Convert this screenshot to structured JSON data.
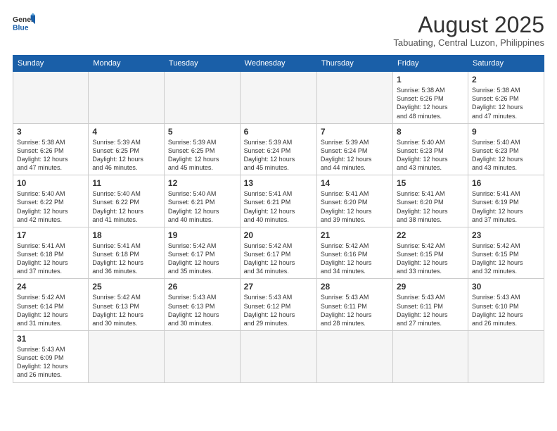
{
  "header": {
    "logo_general": "General",
    "logo_blue": "Blue",
    "month_year": "August 2025",
    "location": "Tabuating, Central Luzon, Philippines"
  },
  "weekdays": [
    "Sunday",
    "Monday",
    "Tuesday",
    "Wednesday",
    "Thursday",
    "Friday",
    "Saturday"
  ],
  "weeks": [
    [
      {
        "day": "",
        "info": ""
      },
      {
        "day": "",
        "info": ""
      },
      {
        "day": "",
        "info": ""
      },
      {
        "day": "",
        "info": ""
      },
      {
        "day": "",
        "info": ""
      },
      {
        "day": "1",
        "info": "Sunrise: 5:38 AM\nSunset: 6:26 PM\nDaylight: 12 hours\nand 48 minutes."
      },
      {
        "day": "2",
        "info": "Sunrise: 5:38 AM\nSunset: 6:26 PM\nDaylight: 12 hours\nand 47 minutes."
      }
    ],
    [
      {
        "day": "3",
        "info": "Sunrise: 5:38 AM\nSunset: 6:26 PM\nDaylight: 12 hours\nand 47 minutes."
      },
      {
        "day": "4",
        "info": "Sunrise: 5:39 AM\nSunset: 6:25 PM\nDaylight: 12 hours\nand 46 minutes."
      },
      {
        "day": "5",
        "info": "Sunrise: 5:39 AM\nSunset: 6:25 PM\nDaylight: 12 hours\nand 45 minutes."
      },
      {
        "day": "6",
        "info": "Sunrise: 5:39 AM\nSunset: 6:24 PM\nDaylight: 12 hours\nand 45 minutes."
      },
      {
        "day": "7",
        "info": "Sunrise: 5:39 AM\nSunset: 6:24 PM\nDaylight: 12 hours\nand 44 minutes."
      },
      {
        "day": "8",
        "info": "Sunrise: 5:40 AM\nSunset: 6:23 PM\nDaylight: 12 hours\nand 43 minutes."
      },
      {
        "day": "9",
        "info": "Sunrise: 5:40 AM\nSunset: 6:23 PM\nDaylight: 12 hours\nand 43 minutes."
      }
    ],
    [
      {
        "day": "10",
        "info": "Sunrise: 5:40 AM\nSunset: 6:22 PM\nDaylight: 12 hours\nand 42 minutes."
      },
      {
        "day": "11",
        "info": "Sunrise: 5:40 AM\nSunset: 6:22 PM\nDaylight: 12 hours\nand 41 minutes."
      },
      {
        "day": "12",
        "info": "Sunrise: 5:40 AM\nSunset: 6:21 PM\nDaylight: 12 hours\nand 40 minutes."
      },
      {
        "day": "13",
        "info": "Sunrise: 5:41 AM\nSunset: 6:21 PM\nDaylight: 12 hours\nand 40 minutes."
      },
      {
        "day": "14",
        "info": "Sunrise: 5:41 AM\nSunset: 6:20 PM\nDaylight: 12 hours\nand 39 minutes."
      },
      {
        "day": "15",
        "info": "Sunrise: 5:41 AM\nSunset: 6:20 PM\nDaylight: 12 hours\nand 38 minutes."
      },
      {
        "day": "16",
        "info": "Sunrise: 5:41 AM\nSunset: 6:19 PM\nDaylight: 12 hours\nand 37 minutes."
      }
    ],
    [
      {
        "day": "17",
        "info": "Sunrise: 5:41 AM\nSunset: 6:18 PM\nDaylight: 12 hours\nand 37 minutes."
      },
      {
        "day": "18",
        "info": "Sunrise: 5:41 AM\nSunset: 6:18 PM\nDaylight: 12 hours\nand 36 minutes."
      },
      {
        "day": "19",
        "info": "Sunrise: 5:42 AM\nSunset: 6:17 PM\nDaylight: 12 hours\nand 35 minutes."
      },
      {
        "day": "20",
        "info": "Sunrise: 5:42 AM\nSunset: 6:17 PM\nDaylight: 12 hours\nand 34 minutes."
      },
      {
        "day": "21",
        "info": "Sunrise: 5:42 AM\nSunset: 6:16 PM\nDaylight: 12 hours\nand 34 minutes."
      },
      {
        "day": "22",
        "info": "Sunrise: 5:42 AM\nSunset: 6:15 PM\nDaylight: 12 hours\nand 33 minutes."
      },
      {
        "day": "23",
        "info": "Sunrise: 5:42 AM\nSunset: 6:15 PM\nDaylight: 12 hours\nand 32 minutes."
      }
    ],
    [
      {
        "day": "24",
        "info": "Sunrise: 5:42 AM\nSunset: 6:14 PM\nDaylight: 12 hours\nand 31 minutes."
      },
      {
        "day": "25",
        "info": "Sunrise: 5:42 AM\nSunset: 6:13 PM\nDaylight: 12 hours\nand 30 minutes."
      },
      {
        "day": "26",
        "info": "Sunrise: 5:43 AM\nSunset: 6:13 PM\nDaylight: 12 hours\nand 30 minutes."
      },
      {
        "day": "27",
        "info": "Sunrise: 5:43 AM\nSunset: 6:12 PM\nDaylight: 12 hours\nand 29 minutes."
      },
      {
        "day": "28",
        "info": "Sunrise: 5:43 AM\nSunset: 6:11 PM\nDaylight: 12 hours\nand 28 minutes."
      },
      {
        "day": "29",
        "info": "Sunrise: 5:43 AM\nSunset: 6:11 PM\nDaylight: 12 hours\nand 27 minutes."
      },
      {
        "day": "30",
        "info": "Sunrise: 5:43 AM\nSunset: 6:10 PM\nDaylight: 12 hours\nand 26 minutes."
      }
    ],
    [
      {
        "day": "31",
        "info": "Sunrise: 5:43 AM\nSunset: 6:09 PM\nDaylight: 12 hours\nand 26 minutes."
      },
      {
        "day": "",
        "info": ""
      },
      {
        "day": "",
        "info": ""
      },
      {
        "day": "",
        "info": ""
      },
      {
        "day": "",
        "info": ""
      },
      {
        "day": "",
        "info": ""
      },
      {
        "day": "",
        "info": ""
      }
    ]
  ]
}
